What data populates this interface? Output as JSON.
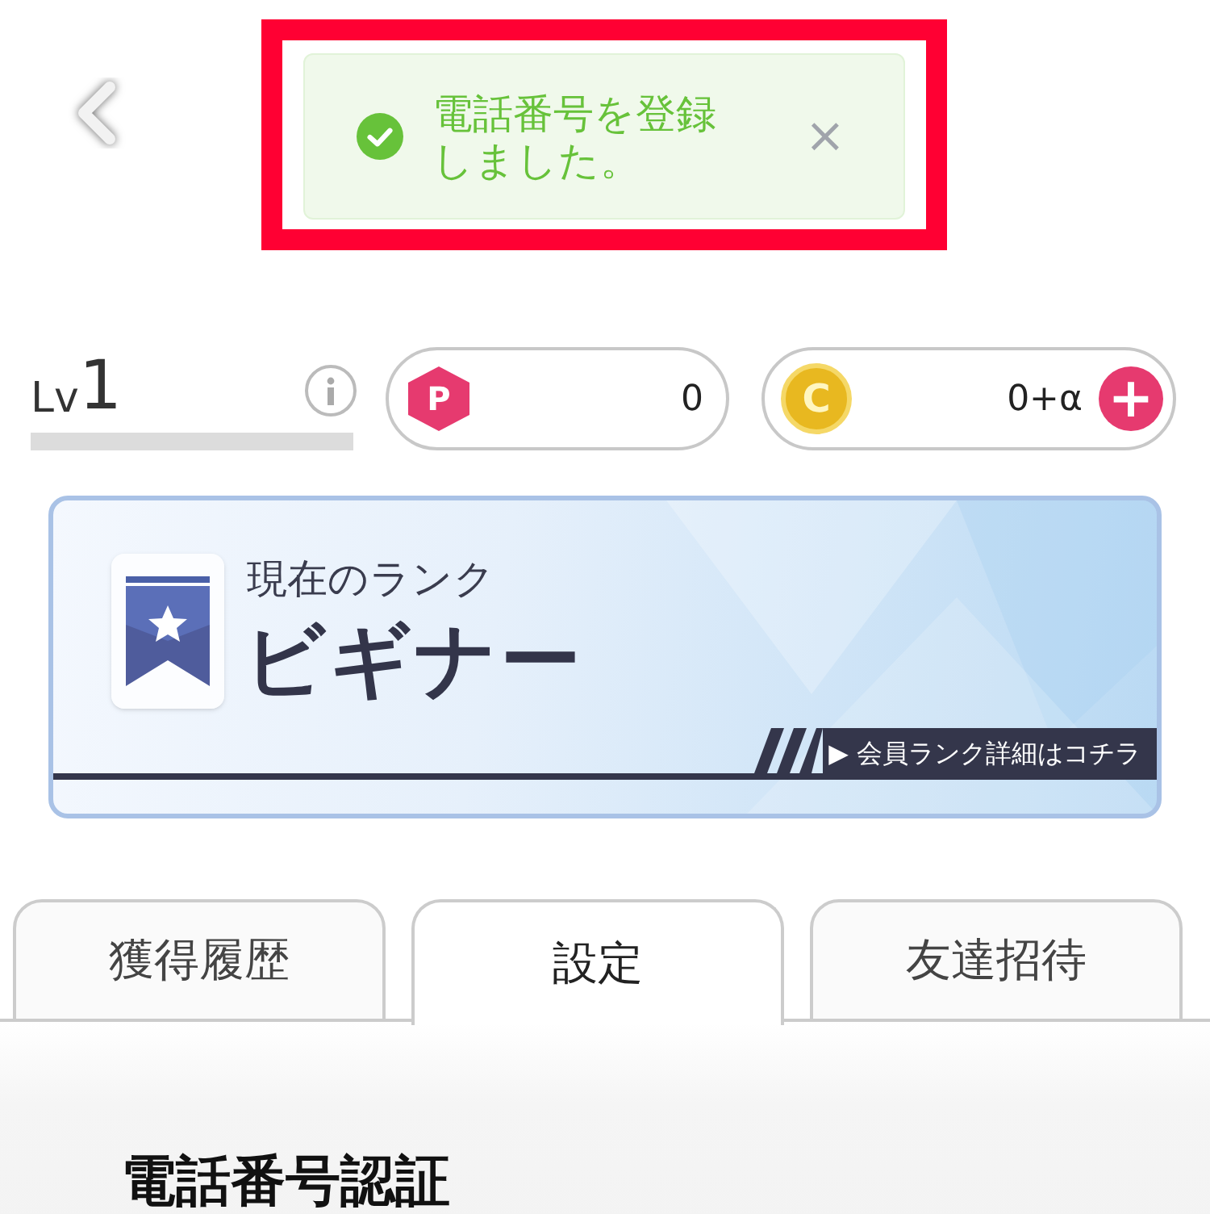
{
  "toast": {
    "message": "電話番号を登録しました。",
    "close": "×"
  },
  "level": {
    "label": "Lv",
    "value": "1"
  },
  "points": {
    "badge": "P",
    "value": "0"
  },
  "coins": {
    "badge": "C",
    "value": "0+α",
    "add": "+"
  },
  "rank": {
    "caption": "現在のランク",
    "name": "ビギナー",
    "link": "▶ 会員ランク詳細はコチラ"
  },
  "tabs": [
    {
      "label": "獲得履歴",
      "selected": false
    },
    {
      "label": "設定",
      "selected": true
    },
    {
      "label": "友達招待",
      "selected": false
    }
  ],
  "section": {
    "heading": "電話番号認証"
  }
}
